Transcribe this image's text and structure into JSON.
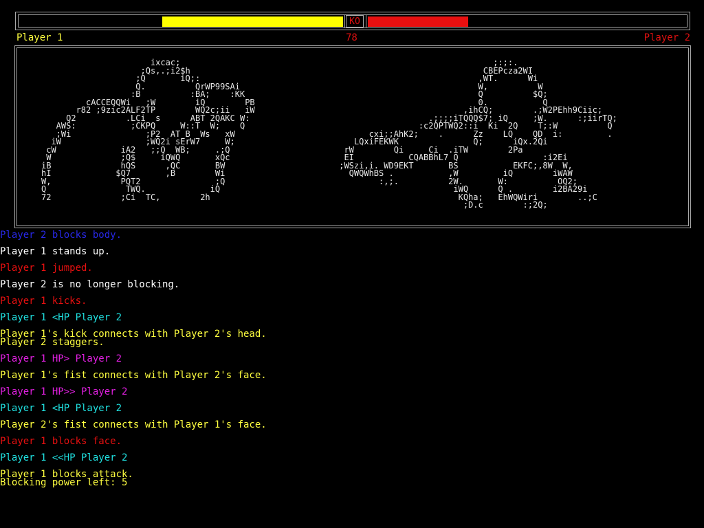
{
  "hud": {
    "ko_label": "KO",
    "player1_hp": 0.56,
    "player2_hp": 0.31,
    "player1_bar_color": "#ffff00",
    "player2_bar_color": "#e81010"
  },
  "labels": {
    "player1": "Player 1",
    "timer": "78",
    "player2": "Player 2"
  },
  "arena": {
    "player1_ascii": "                      ixcac;\n                    ;Qs,.;i2$h\n                   ;Q       iQ;:\n                   Q.          QrWP99SAi\n                  :B          :BA;    :KK\n         cACCEQQWi   ;W        iQ        PB\n       r82 ;9zic2ALF2TP        WQ2c;ii   iW\n     Q2          .LCi  s      ABT 2QAKC W:\n   AWS:           ;CKPQ     W::T  W;    Q\n   ;Wi               ;P2  AT B  Ws   xW\n  iW                 ;WQ2i sErW7     W;\n cW             iA2   ;;Q  WB;     .;Q\n W              ;Q$     iQWQ       xQc\niB              hQS      ,QC       BW\nhI             $Q7       ,B        Wi\nW,              PQT2               ;Q\nQ                TWQ.             iQ\n72              ;Ci  TC,        2h",
    "player2_ascii": "                                ;:;:.\n                              CBEPcza2WI\n                             ,WT.      Wi\n                             W,          W\n                             Q          $Q;\n                             0.           Q\n                          ,ihCQ;        .;W2PEhh9Ciic;\n                   .;;;;iTQQQ$7; iQ     ;W.      :;iirTQ;\n                 :c2QPTWQ2::i  Ki  2Q    T;:W          Q\n       cxi;;AhK2;    .      Zz    LQ    QD  i:         .\n    LQxiFEKWK               Q;      iQx.2Qi\n  rW        Qi     Ci  .iTW        2Pa\n  EI           CQABBhL7 Q                 :i2Ei\n ;WSzi,i. WD9EKT       BS           EKFC;,8W  W,\n   QWQWhBS .           ,W         iQ        iWAW\n         :,;.          2W.       W:          OQ2;\n                        iWQ      Q .        i2BA29i\n                         KQha;   EhWQWiri        ..;C\n                          ;D.c        :;2Q;"
  },
  "log": [
    {
      "text": "Player 2 blocks body.",
      "color": "#2828e8"
    },
    {
      "text": "Player 1 stands up.",
      "color": "#ffffff"
    },
    {
      "text": "Player 1 jumped.",
      "color": "#e81010"
    },
    {
      "text": "Player 2 is no longer blocking.",
      "color": "#ffffff"
    },
    {
      "text": "Player 1 kicks.",
      "color": "#e81010"
    },
    {
      "text": "Player 1 <HP Player 2",
      "color": "#20e0e0"
    },
    {
      "text": "Player 1's kick connects with Player 2's head.",
      "color": "#ffff40"
    },
    {
      "text": "Player 2 staggers.",
      "color": "#ffff40",
      "tight": true
    },
    {
      "text": "Player 1 HP> Player 2",
      "color": "#e020e0"
    },
    {
      "text": "Player 1's fist connects with Player 2's face.",
      "color": "#ffff40"
    },
    {
      "text": "Player 1 HP>> Player 2",
      "color": "#e020e0"
    },
    {
      "text": "Player 1 <HP Player 2",
      "color": "#20e0e0"
    },
    {
      "text": "Player 2's fist connects with Player 1's face.",
      "color": "#ffff40"
    },
    {
      "text": "Player 1 blocks face.",
      "color": "#e81010"
    },
    {
      "text": "Player 1 <<HP Player 2",
      "color": "#20e0e0"
    },
    {
      "text": "Player 1 blocks attack.",
      "color": "#ffff40"
    },
    {
      "text": "Blocking power left: 5",
      "color": "#ffff40",
      "tight": true
    }
  ]
}
